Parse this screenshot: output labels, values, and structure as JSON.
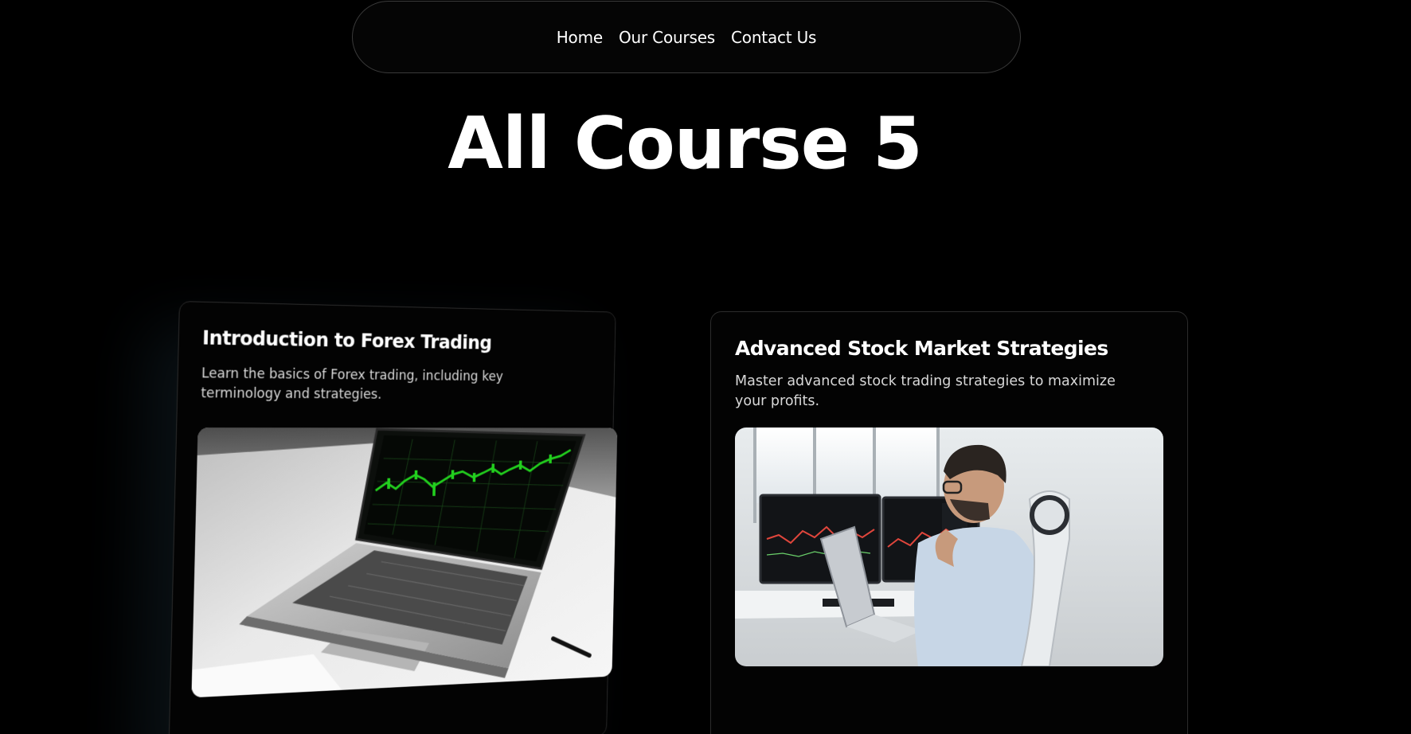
{
  "nav": {
    "items": [
      {
        "label": "Home"
      },
      {
        "label": "Our Courses"
      },
      {
        "label": "Contact Us"
      }
    ]
  },
  "page": {
    "title": "All Course 5"
  },
  "courses": [
    {
      "title": "Introduction to Forex Trading",
      "description": "Learn the basics of Forex trading, including key terminology and strategies.",
      "image_icon": "laptop-trading-chart-image"
    },
    {
      "title": "Advanced Stock Market Strategies",
      "description": "Master advanced stock trading strategies to maximize your profits.",
      "image_icon": "trader-at-monitors-image"
    }
  ],
  "colors": {
    "background": "#000000",
    "text": "#ffffff",
    "card_border": "#2c2c2c",
    "chart_green": "#22d01e"
  }
}
